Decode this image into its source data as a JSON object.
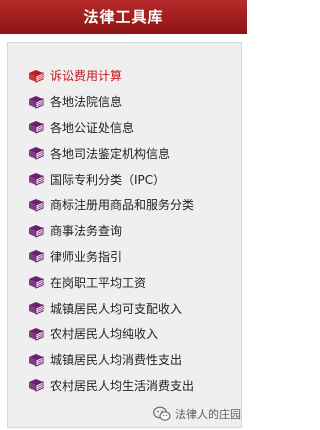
{
  "header": {
    "title": "法律工具库"
  },
  "items": [
    {
      "label": "诉讼费用计算",
      "active": true
    },
    {
      "label": "各地法院信息",
      "active": false
    },
    {
      "label": "各地公证处信息",
      "active": false
    },
    {
      "label": "各地司法鉴定机构信息",
      "active": false
    },
    {
      "label": "国际专利分类（IPC）",
      "active": false
    },
    {
      "label": "商标注册用商品和服务分类",
      "active": false
    },
    {
      "label": "商事法务查询",
      "active": false
    },
    {
      "label": "律师业务指引",
      "active": false
    },
    {
      "label": "在岗职工平均工资",
      "active": false
    },
    {
      "label": "城镇居民人均可支配收入",
      "active": false
    },
    {
      "label": "农村居民人均纯收入",
      "active": false
    },
    {
      "label": "城镇居民人均消费性支出",
      "active": false
    },
    {
      "label": "农村居民人均生活消费支出",
      "active": false
    }
  ],
  "watermark": {
    "text": "法律人的庄园",
    "icon": "wechat-icon"
  },
  "colors": {
    "header_bg": "#a11f1f",
    "active_text": "#c0181e",
    "book_purple": "#6b1f6e",
    "book_red": "#c0181e"
  }
}
